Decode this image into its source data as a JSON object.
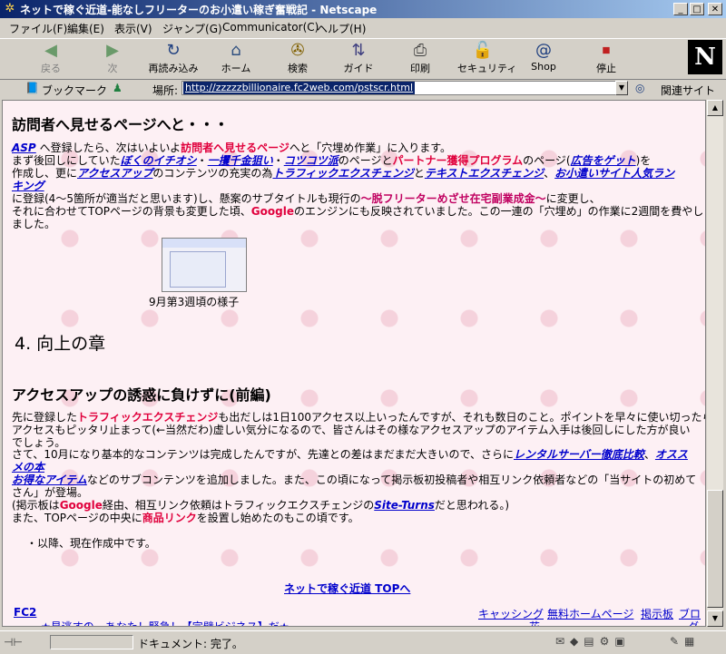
{
  "window": {
    "title": "ネットで稼ぐ近道-能なしフリーターのお小遣い稼ぎ奮戦記 - Netscape"
  },
  "menu": [
    "ファイル(F)",
    "編集(E)",
    "表示(V)",
    "ジャンプ(G)",
    "Communicator(C)",
    "ヘルプ(H)"
  ],
  "toolbar": {
    "back": "戻る",
    "forward": "次",
    "reload": "再読み込み",
    "home": "ホーム",
    "search": "検索",
    "guide": "ガイド",
    "print": "印刷",
    "security": "セキュリティ",
    "shop": "Shop",
    "stop": "停止"
  },
  "location": {
    "bookmarks": "ブックマーク",
    "label": "場所:",
    "url": "http://zzzzzbillionaire.fc2web.com/pstscr.html",
    "related": "関連サイト"
  },
  "content": {
    "section1_heading": "訪問者へ見せるページへと・・・",
    "p1": {
      "l1_a": "ASP",
      "l1_b": "へ登録したら、次はいよいよ",
      "l1_c": "訪問者へ見せるページ",
      "l1_d": "へと「穴埋め作業」に入ります。",
      "l2_a": "まず後回しにしていた",
      "l2_b": "ぼくのイチオシ",
      "l2_c": "・",
      "l2_d": "一攫千金狙い",
      "l2_e": "・",
      "l2_f": "コツコツ派",
      "l2_g": "のページと",
      "l2_h": "パートナー獲得プログラム",
      "l2_i": "のページ(",
      "l2_j": "広告をゲット",
      "l2_k": ")を",
      "l3_a": "作成し、更に",
      "l3_b": "アクセスアップ",
      "l3_c": "のコンテンツの充実の為",
      "l3_d": "トラフィックエクスチェンジ",
      "l3_e": "と",
      "l3_f": "テキストエクスチェンジ",
      "l3_g": "、",
      "l3_h": "お小遣いサイト人気ラン",
      "l4_a": "キング",
      "l5_a": "に登録(4〜5箇所が適当だと思います)し、懸案のサブタイトルも現行の",
      "l5_b": "〜脱フリーターめざせ在宅副業成金〜",
      "l5_c": "に変更し、",
      "l6_a": "それに合わせてTOPページの背景も変更した頃、",
      "l6_b": "Google",
      "l6_c": "のエンジンにも反映されていました。この一連の「穴埋め」の作業に2週間を費やし",
      "l7_a": "ました。"
    },
    "caption": "9月第3週頃の様子",
    "chapter": "4. 向上の章",
    "section2_heading": "アクセスアップの誘惑に負けずに(前編)",
    "p2": {
      "l1_a": "先に登録した",
      "l1_b": "トラフィックエクスチェンジ",
      "l1_c": "も出だしは1日100アクセス以上いったんですが、それも数日のこと。ポイントを早々に使い切ったら、",
      "l2_a": "アクセスもピッタリ止まって(←当然だわ)虚しい気分になるので、皆さんはその様なアクセスアップのアイテム入手は後回しにした方が良い",
      "l3_a": "でしょう。",
      "l4_a": "さて、10月になり基本的なコンテンツは完成したんですが、先達との差はまだまだ大きいので、さらに",
      "l4_b": "レンタルサーバー徹底比較",
      "l4_c": "、",
      "l4_d": "オスス",
      "l5_a": "メの本",
      "l6_a": "お得なアイテム",
      "l6_b": "などのサブコンテンツを追加しました。また、この頃になって掲示板初投稿者や相互リンク依頼者などの「当サイトの初めて",
      "l7_a": "さん」が登場。",
      "l8_a": "(掲示板は",
      "l8_b": "Google",
      "l8_c": "経由、相互リンク依頼はトラフィックエクスチェンジの",
      "l8_d": "Site-Turns",
      "l8_e": "だと思われる。)",
      "l9_a": "また、TOPページの中央に",
      "l9_b": "商品リンク",
      "l9_c": "を設置し始めたのもこの頃です。"
    },
    "note": "・以降、現在作成中です。",
    "top_link": "ネットで稼ぐ近道 TOPへ",
    "footer": {
      "fc2": "FC2",
      "ad": "★見逃すの、あなた！緊急！【完璧ビジネス】だ★",
      "link1": "キャッシング",
      "link1b": "花",
      "link2": "無料ホームページ",
      "link3": "掲示板",
      "link4": "ブロ",
      "link4b": "グ"
    }
  },
  "status": {
    "text": "ドキュメント: 完了。"
  },
  "colors": {
    "title_bar_start": "#0a246a",
    "link": "#0000cc",
    "highlight": "#e0003c",
    "page_bg": "#fdf0f4"
  }
}
